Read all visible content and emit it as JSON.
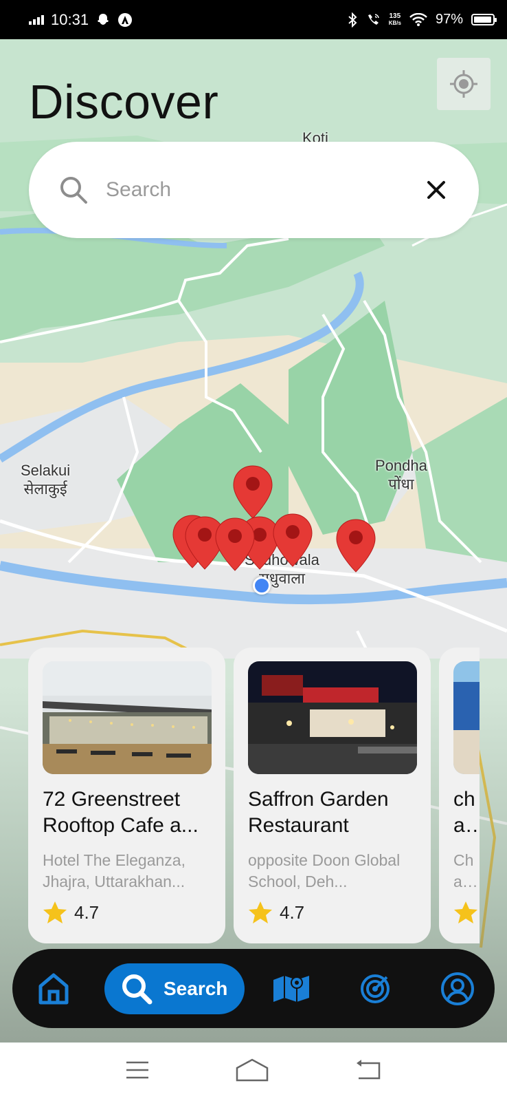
{
  "status_bar": {
    "time": "10:31",
    "net_speed_value": "135",
    "net_speed_unit": "KB/s",
    "battery": "97%",
    "battery_level": 0.97
  },
  "page": {
    "title": "Discover"
  },
  "search": {
    "placeholder": "Search",
    "value": ""
  },
  "map": {
    "labels": [
      {
        "en": "Selakui",
        "hi": "सेलाकुई"
      },
      {
        "en": "Pondha",
        "hi": "पोंधा"
      },
      {
        "en": "Sudhowala",
        "hi": "सुधुवाला"
      },
      {
        "en": "Koti",
        "hi": ""
      }
    ],
    "marker_count": 7
  },
  "cards": [
    {
      "title": "72 Greenstreet Rooftop Cafe a...",
      "address": "Hotel The Eleganza, Jhajra, Uttarakhan...",
      "rating": "4.7"
    },
    {
      "title": "Saffron Garden Restaurant",
      "address": "opposite Doon Global School, Deh...",
      "rating": "4.7"
    },
    {
      "title": "cha res",
      "address": "Cha nea",
      "rating": ""
    }
  ],
  "bottom_nav": {
    "active_label": "Search",
    "items": [
      "home-icon",
      "search-icon",
      "map-icon",
      "radar-icon",
      "profile-icon"
    ],
    "accent_color": "#0a77d0"
  },
  "colors": {
    "pin": "#e53935",
    "user_dot": "#4285f4"
  }
}
